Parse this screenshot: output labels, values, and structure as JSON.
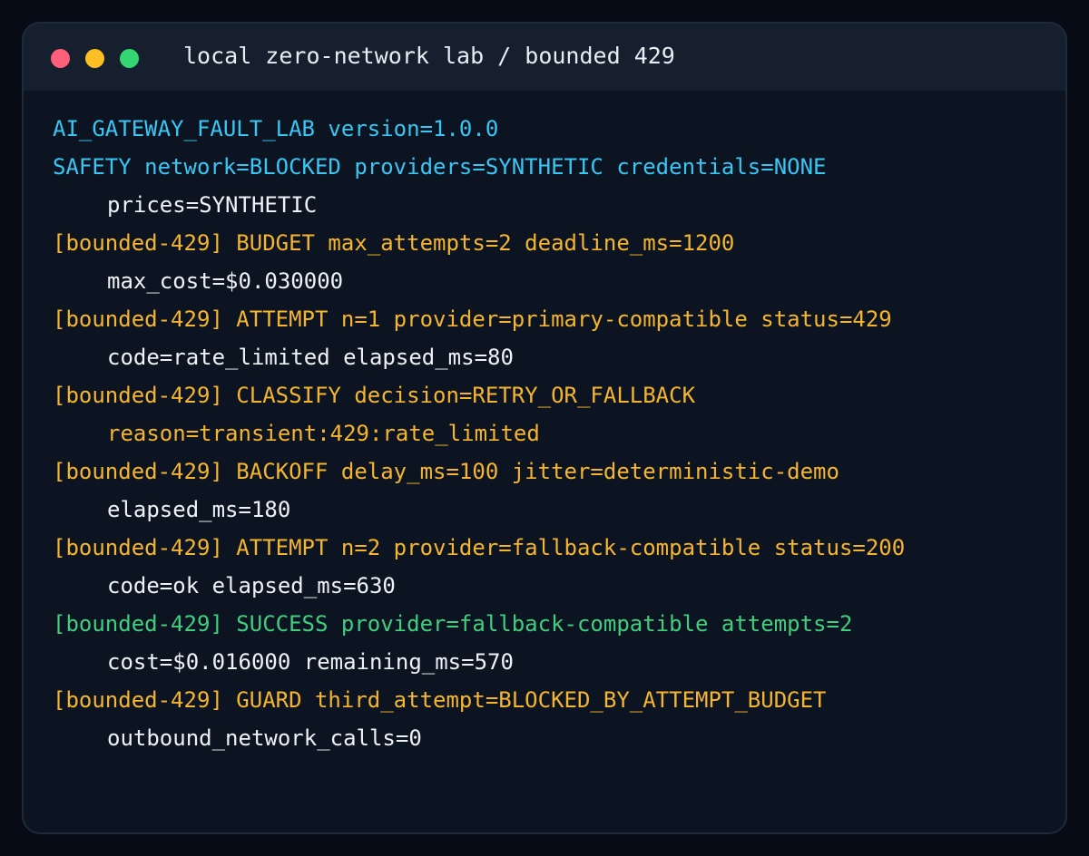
{
  "colors": {
    "red_dot": "#ff5f7a",
    "yellow_dot": "#fbbf24",
    "green_dot": "#34d673"
  },
  "window": {
    "title": "local zero-network lab / bounded 429"
  },
  "log_lines": [
    {
      "text": "AI_GATEWAY_FAULT_LAB version=1.0.0",
      "color": "cyan",
      "indent": false
    },
    {
      "text": "SAFETY network=BLOCKED providers=SYNTHETIC credentials=NONE",
      "color": "cyan",
      "indent": false
    },
    {
      "text": "prices=SYNTHETIC",
      "color": "white",
      "indent": true
    },
    {
      "text": "[bounded-429] BUDGET max_attempts=2 deadline_ms=1200",
      "color": "amber",
      "indent": false
    },
    {
      "text": "max_cost=$0.030000",
      "color": "white",
      "indent": true
    },
    {
      "text": "[bounded-429] ATTEMPT n=1 provider=primary-compatible status=429",
      "color": "amber",
      "indent": false
    },
    {
      "text": "code=rate_limited elapsed_ms=80",
      "color": "white",
      "indent": true
    },
    {
      "text": "[bounded-429] CLASSIFY decision=RETRY_OR_FALLBACK",
      "color": "amber",
      "indent": false
    },
    {
      "text": "reason=transient:429:rate_limited",
      "color": "amber",
      "indent": true
    },
    {
      "text": "[bounded-429] BACKOFF delay_ms=100 jitter=deterministic-demo",
      "color": "amber",
      "indent": false
    },
    {
      "text": "elapsed_ms=180",
      "color": "white",
      "indent": true
    },
    {
      "text": "[bounded-429] ATTEMPT n=2 provider=fallback-compatible status=200",
      "color": "amber",
      "indent": false
    },
    {
      "text": "code=ok elapsed_ms=630",
      "color": "white",
      "indent": true
    },
    {
      "text": "[bounded-429] SUCCESS provider=fallback-compatible attempts=2",
      "color": "green",
      "indent": false
    },
    {
      "text": "cost=$0.016000 remaining_ms=570",
      "color": "white",
      "indent": true
    },
    {
      "text": "[bounded-429] GUARD third_attempt=BLOCKED_BY_ATTEMPT_BUDGET",
      "color": "amber",
      "indent": false
    },
    {
      "text": "outbound_network_calls=0",
      "color": "white",
      "indent": true
    }
  ]
}
